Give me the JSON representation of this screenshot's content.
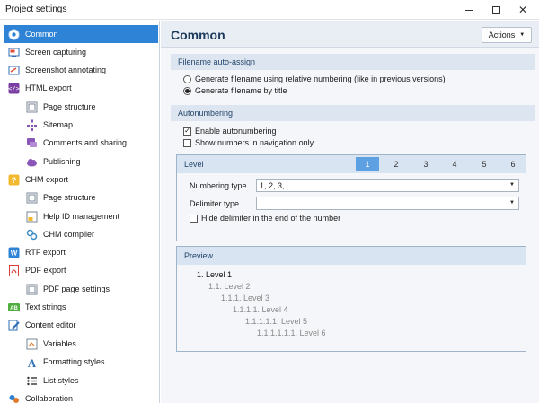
{
  "window": {
    "title": "Project settings"
  },
  "sidebar": {
    "items": [
      {
        "label": "Common",
        "icon": "gear-icon",
        "active": true
      },
      {
        "label": "Screen capturing",
        "icon": "screen-capture-icon"
      },
      {
        "label": "Screenshot annotating",
        "icon": "annotate-icon"
      },
      {
        "label": "HTML export",
        "icon": "html-icon"
      },
      {
        "label": "Page structure",
        "icon": "page-structure-icon"
      },
      {
        "label": "Sitemap",
        "icon": "sitemap-icon"
      },
      {
        "label": "Comments and sharing",
        "icon": "comments-icon"
      },
      {
        "label": "Publishing",
        "icon": "cloud-publish-icon"
      },
      {
        "label": "CHM export",
        "icon": "chm-icon"
      },
      {
        "label": "Page structure",
        "icon": "page-structure-icon"
      },
      {
        "label": "Help ID management",
        "icon": "help-id-icon"
      },
      {
        "label": "CHM compiler",
        "icon": "compiler-icon"
      },
      {
        "label": "RTF export",
        "icon": "rtf-icon"
      },
      {
        "label": "PDF export",
        "icon": "pdf-icon"
      },
      {
        "label": "PDF page settings",
        "icon": "page-settings-icon"
      },
      {
        "label": "Text strings",
        "icon": "text-strings-icon"
      },
      {
        "label": "Content editor",
        "icon": "content-editor-icon"
      },
      {
        "label": "Variables",
        "icon": "variables-icon"
      },
      {
        "label": "Formatting styles",
        "icon": "formatting-styles-icon"
      },
      {
        "label": "List styles",
        "icon": "list-styles-icon"
      },
      {
        "label": "Collaboration",
        "icon": "collaboration-icon"
      }
    ]
  },
  "main": {
    "title": "Common",
    "actions_label": "Actions",
    "filename_section": {
      "heading": "Filename auto-assign",
      "option_relative": "Generate filename using relative numbering (like in previous versions)",
      "option_title": "Generate filename by title",
      "selected": "title"
    },
    "autonumbering_section": {
      "heading": "Autonumbering",
      "enable_label": "Enable autonumbering",
      "enable_checked": true,
      "show_nav_label": "Show numbers in navigation only",
      "show_nav_checked": false
    },
    "level": {
      "label": "Level",
      "tabs": [
        "1",
        "2",
        "3",
        "4",
        "5",
        "6"
      ],
      "selected": "1",
      "numbering_type_label": "Numbering type",
      "numbering_type_value": "1, 2, 3, ...",
      "delimiter_type_label": "Delimiter type",
      "delimiter_type_value": ".",
      "hide_delimiter_label": "Hide delimiter in the end of the number",
      "hide_delimiter_checked": false
    },
    "preview": {
      "label": "Preview",
      "lines": [
        "1. Level 1",
        "1.1. Level 2",
        "1.1.1. Level 3",
        "1.1.1.1. Level 4",
        "1.1.1.1.1. Level 5",
        "1.1.1.1.1.1. Level 6"
      ]
    }
  },
  "colors": {
    "accent": "#2f83d6",
    "section_header_bg": "#dde6f0",
    "title_text": "#1c3a5c"
  }
}
